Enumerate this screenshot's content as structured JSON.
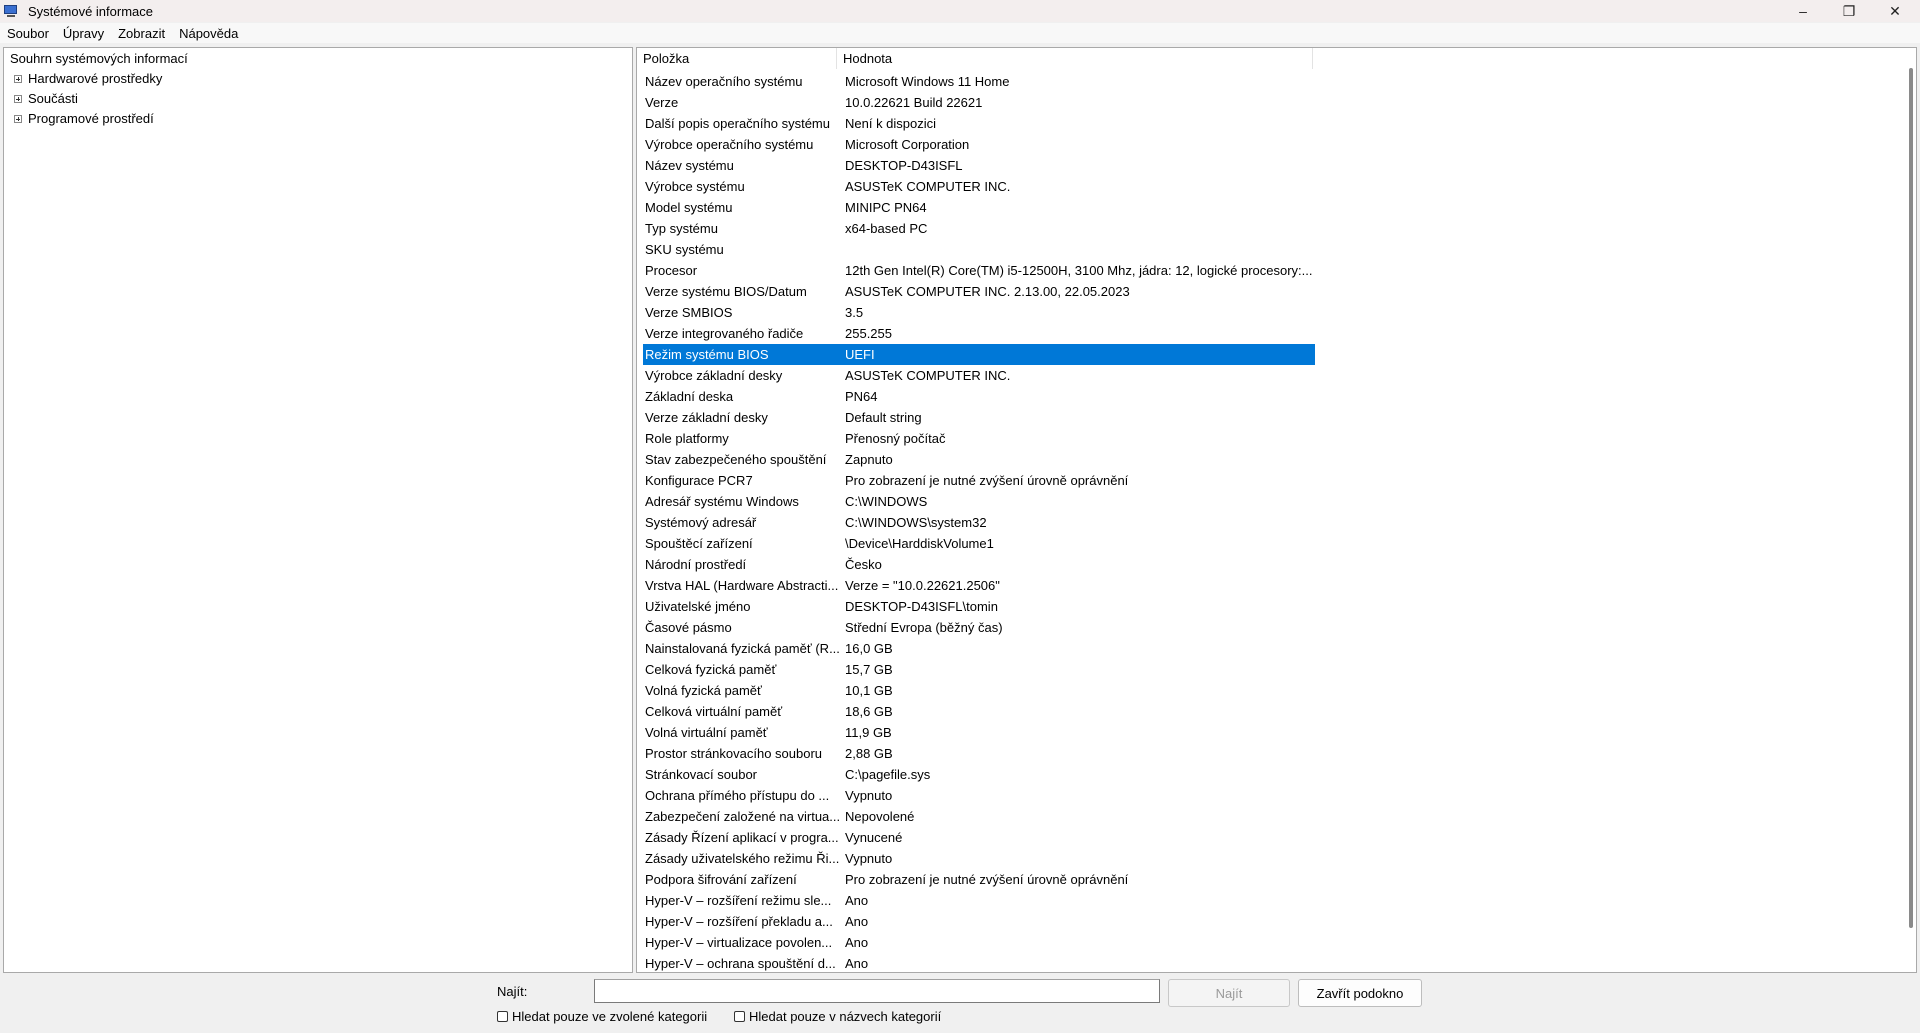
{
  "window": {
    "title": "Systémové informace"
  },
  "window_controls": {
    "minimize": "–",
    "maximize": "❐",
    "close": "✕"
  },
  "menu": [
    "Soubor",
    "Úpravy",
    "Zobrazit",
    "Nápověda"
  ],
  "tree": {
    "root": "Souhrn systémových informací",
    "children": [
      "Hardwarové prostředky",
      "Součásti",
      "Programové prostředí"
    ]
  },
  "table": {
    "headers": [
      "Položka",
      "Hodnota"
    ],
    "selected_index": 13,
    "rows": [
      [
        "Název operačního systému",
        "Microsoft Windows 11 Home"
      ],
      [
        "Verze",
        "10.0.22621 Build 22621"
      ],
      [
        "Další popis operačního systému",
        "Není k dispozici"
      ],
      [
        "Výrobce operačního systému",
        "Microsoft Corporation"
      ],
      [
        "Název systému",
        "DESKTOP-D43ISFL"
      ],
      [
        "Výrobce systému",
        "ASUSTeK COMPUTER INC."
      ],
      [
        "Model systému",
        "MINIPC PN64"
      ],
      [
        "Typ systému",
        "x64-based PC"
      ],
      [
        "SKU systému",
        ""
      ],
      [
        "Procesor",
        "12th Gen Intel(R) Core(TM) i5-12500H, 3100 Mhz, jádra: 12, logické procesory:..."
      ],
      [
        "Verze systému BIOS/Datum",
        "ASUSTeK COMPUTER INC. 2.13.00, 22.05.2023"
      ],
      [
        "Verze SMBIOS",
        "3.5"
      ],
      [
        "Verze integrovaného řadiče",
        "255.255"
      ],
      [
        "Režim systému BIOS",
        "UEFI"
      ],
      [
        "Výrobce základní desky",
        "ASUSTeK COMPUTER INC."
      ],
      [
        "Základní deska",
        "PN64"
      ],
      [
        "Verze základní desky",
        "Default string"
      ],
      [
        "Role platformy",
        "Přenosný počítač"
      ],
      [
        "Stav zabezpečeného spouštění",
        "Zapnuto"
      ],
      [
        "Konfigurace PCR7",
        "Pro zobrazení je nutné zvýšení úrovně oprávnění"
      ],
      [
        "Adresář systému Windows",
        "C:\\WINDOWS"
      ],
      [
        "Systémový adresář",
        "C:\\WINDOWS\\system32"
      ],
      [
        "Spouštěcí zařízení",
        "\\Device\\HarddiskVolume1"
      ],
      [
        "Národní prostředí",
        "Česko"
      ],
      [
        "Vrstva HAL (Hardware Abstracti...",
        "Verze = \"10.0.22621.2506\""
      ],
      [
        "Uživatelské jméno",
        "DESKTOP-D43ISFL\\tomin"
      ],
      [
        "Časové pásmo",
        "Střední Evropa (běžný čas)"
      ],
      [
        "Nainstalovaná fyzická paměť (R...",
        "16,0 GB"
      ],
      [
        "Celková fyzická paměť",
        "15,7 GB"
      ],
      [
        "Volná fyzická paměť",
        "10,1 GB"
      ],
      [
        "Celková virtuální paměť",
        "18,6 GB"
      ],
      [
        "Volná virtuální paměť",
        "11,9 GB"
      ],
      [
        "Prostor stránkovacího souboru",
        "2,88 GB"
      ],
      [
        "Stránkovací soubor",
        "C:\\pagefile.sys"
      ],
      [
        "Ochrana přímého přístupu do ...",
        "Vypnuto"
      ],
      [
        "Zabezpečení založené na virtua...",
        "Nepovolené"
      ],
      [
        "Zásady Řízení aplikací v progra...",
        "Vynucené"
      ],
      [
        "Zásady uživatelského režimu Ři...",
        "Vypnuto"
      ],
      [
        "Podpora šifrování zařízení",
        "Pro zobrazení je nutné zvýšení úrovně oprávnění"
      ],
      [
        "Hyper-V – rozšíření režimu sle...",
        "Ano"
      ],
      [
        "Hyper-V – rozšíření překladu a...",
        "Ano"
      ],
      [
        "Hyper-V – virtualizace povolen...",
        "Ano"
      ],
      [
        "Hyper-V – ochrana spouštění d...",
        "Ano"
      ]
    ]
  },
  "search": {
    "label": "Najít:",
    "value": "",
    "find_button": "Najít",
    "close_button": "Zavřít podokno",
    "check_selected": "Hledat pouze ve zvolené kategorii",
    "check_names": "Hledat pouze v názvech kategorií"
  }
}
